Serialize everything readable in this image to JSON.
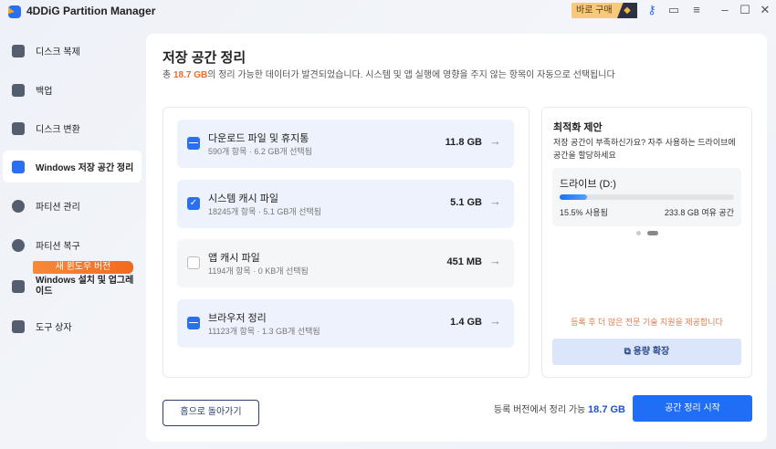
{
  "app": {
    "title": "4DDiG Partition Manager",
    "buy_label": "바로 구매"
  },
  "sidebar": {
    "items": [
      {
        "label": "디스크 복제"
      },
      {
        "label": "백업"
      },
      {
        "label": "디스크 변환"
      },
      {
        "label": "Windows 저장 공간 정리"
      },
      {
        "label": "파티션 관리"
      },
      {
        "label": "파티션 복구"
      },
      {
        "label": "Windows 설치 및 업그레이드"
      },
      {
        "label": "도구 상자"
      }
    ],
    "badge": "새 윈도우 버전"
  },
  "main": {
    "title": "저장 공간 정리",
    "subtitle_pre": "총 ",
    "subtitle_amount": "18.7 GB",
    "subtitle_post": "의 정리 가능한 데이터가 발견되었습니다. 시스템 및 앱 실행에 영향을 주지 않는 항목이 자동으로 선택됩니다",
    "items": [
      {
        "name": "다운로드 파일 및 휴지통",
        "detail": "590개 항목 · 6.2 GB개 선택됨",
        "size": "11.8 GB",
        "state": "partial"
      },
      {
        "name": "시스템 캐시 파일",
        "detail": "18245개 항목 · 5.1 GB개 선택됨",
        "size": "5.1 GB",
        "state": "checked"
      },
      {
        "name": "앱 캐시 파일",
        "detail": "1194개 항목 · 0 KB개 선택됨",
        "size": "451 MB",
        "state": "unchecked"
      },
      {
        "name": "브라우저 정리",
        "detail": "11123개 항목 · 1.3 GB개 선택됨",
        "size": "1.4 GB",
        "state": "partial"
      }
    ]
  },
  "suggest": {
    "title": "최적화 제안",
    "desc": "저장 공간이 부족하신가요? 자주 사용하는 드라이브에 공간을 할당하세요",
    "drive": "드라이브 (D:)",
    "used_label": "15.5% 사용됨",
    "used_fraction": 0.155,
    "free_label": "233.8 GB 여유 공간",
    "promo": "등록 후 더 많은 전문 기술 지원을 제공합니다",
    "expand_label": "용량 확장"
  },
  "footer": {
    "back_label": "홈으로 돌아가기",
    "total_pre": "등록 버전에서 정리 가능 ",
    "total_amount": "18.7 GB",
    "start_label": "공간 정리 시작"
  }
}
